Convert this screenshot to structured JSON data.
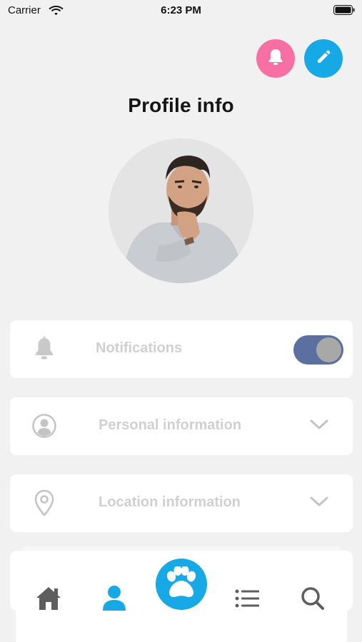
{
  "status_bar": {
    "carrier": "Carrier",
    "time": "6:23 PM",
    "wifi_icon": "wifi-icon",
    "battery_icon": "battery-icon"
  },
  "header": {
    "title": "Profile info",
    "notification_button_icon": "bell-icon",
    "edit_button_icon": "pencil-icon"
  },
  "profile": {
    "avatar_icon": "user-photo"
  },
  "settings": [
    {
      "label": "Notifications",
      "icon": "bell-icon",
      "control": "toggle",
      "toggle_on": true
    },
    {
      "label": "Personal information",
      "icon": "user-circle-icon",
      "control": "chevron-down"
    },
    {
      "label": "Location information",
      "icon": "location-pin-icon",
      "control": "chevron-down"
    }
  ],
  "bottom_nav": {
    "items": [
      "home-icon",
      "user-icon",
      "paw-icon",
      "list-icon",
      "search-icon"
    ],
    "active": "user-icon"
  },
  "colors": {
    "background": "#f1f1f1",
    "accent_blue": "#17a8e6",
    "accent_pink": "#f76fa3",
    "toggle_track": "#5b6fa0",
    "label_gray": "#d0d0d0",
    "icon_gray": "#5e5e5e"
  }
}
